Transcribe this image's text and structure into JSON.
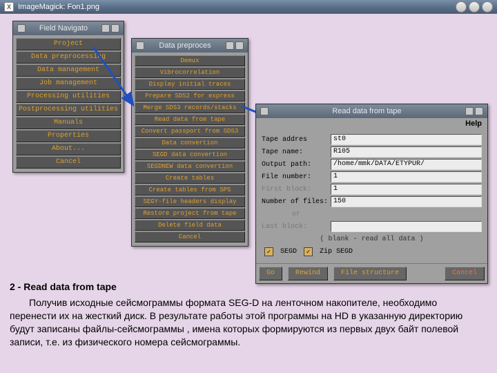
{
  "main_window": {
    "title": "ImageMagick: Fon1.png"
  },
  "panel1": {
    "title": "Field Navigato",
    "items": [
      "Project",
      "Data preprocessing",
      "Data management",
      "Job management",
      "Processing utilities",
      "Postprocessing utilities",
      "Manuals",
      "Properties",
      "About...",
      "Cancel"
    ]
  },
  "panel2": {
    "title": "Data preproces",
    "items": [
      "Demux",
      "Vibrocorrelation",
      "Display initial traces",
      "Prepare SDS2 for express",
      "Merge SDS3 records/stacks",
      "Read data from tape",
      "Convert passport from SDS3",
      "Data convertion",
      "SEGD data convertion",
      "SEGDNEW data convertion",
      "Create tables",
      "Create tables from SPS",
      "SEGY-file headers display",
      "Restore project from tape",
      "Delete field data",
      "Cancel"
    ]
  },
  "panel3": {
    "title": "Read data from tape",
    "help": "Help",
    "fields": {
      "tape_addr_label": "Tape addres",
      "tape_addr_val": "st0",
      "tape_name_label": "Tape name:",
      "tape_name_val": "R105",
      "output_path_label": "Output path:",
      "output_path_val": "/home/mmk/DATA/ETYPUR/",
      "file_number_label": "File number:",
      "file_number_val": "1",
      "first_block_label": "First block:",
      "first_block_val": "1",
      "num_files_label": "Number of files:",
      "num_files_val": "150",
      "or_label": "or",
      "last_block_label": "Last block:",
      "last_block_val": ""
    },
    "hint": "( blank - read all data )",
    "check_segd": "SEGD",
    "check_zip": "Zip SEGD",
    "buttons": {
      "go": "Go",
      "rewind": "Rewind",
      "fs": "File structure",
      "cancel": "Cancel"
    }
  },
  "desc": {
    "heading": "2 - Read data from tape",
    "body": "Получив исходные сейсмограммы формата SEG-D  на ленточном накопителе, необходимо перенести их на жесткий диск.  В результате работы этой программы на HD в указанную директорию будут записаны файлы-сейсмограммы , имена которых формируются из первых двух байт полевой записи, т.е. из физического номера сейсмограммы."
  }
}
